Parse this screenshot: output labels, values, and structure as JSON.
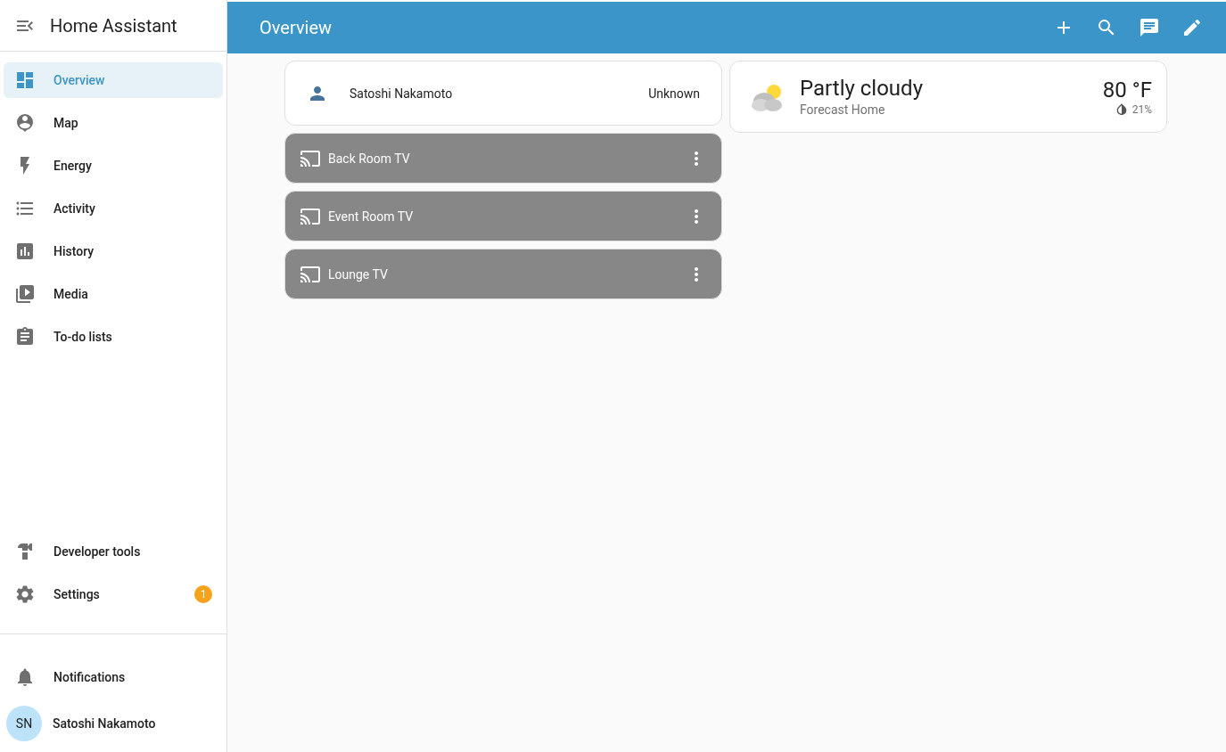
{
  "sidebar": {
    "title": "Home Assistant",
    "items": [
      {
        "label": "Overview",
        "selected": true
      },
      {
        "label": "Map",
        "selected": false
      },
      {
        "label": "Energy",
        "selected": false
      },
      {
        "label": "Activity",
        "selected": false
      },
      {
        "label": "History",
        "selected": false
      },
      {
        "label": "Media",
        "selected": false
      },
      {
        "label": "To-do lists",
        "selected": false
      }
    ],
    "bottom_items": [
      {
        "label": "Developer tools",
        "selected": false
      },
      {
        "label": "Settings",
        "selected": false,
        "badge": "1"
      }
    ],
    "notifications": "Notifications",
    "user": {
      "initials": "SN",
      "name": "Satoshi Nakamoto"
    }
  },
  "header": {
    "title": "Overview"
  },
  "person_card": {
    "name": "Satoshi Nakamoto",
    "state": "Unknown"
  },
  "media_players": [
    {
      "name": "Back Room TV",
      "on": false
    },
    {
      "name": "Event Room TV",
      "on": false
    },
    {
      "name": "Lounge TV",
      "on": false
    }
  ],
  "weather": {
    "condition": "Partly cloudy",
    "location": "Forecast Home",
    "temperature": "80 °F",
    "precipitation": "21%"
  }
}
